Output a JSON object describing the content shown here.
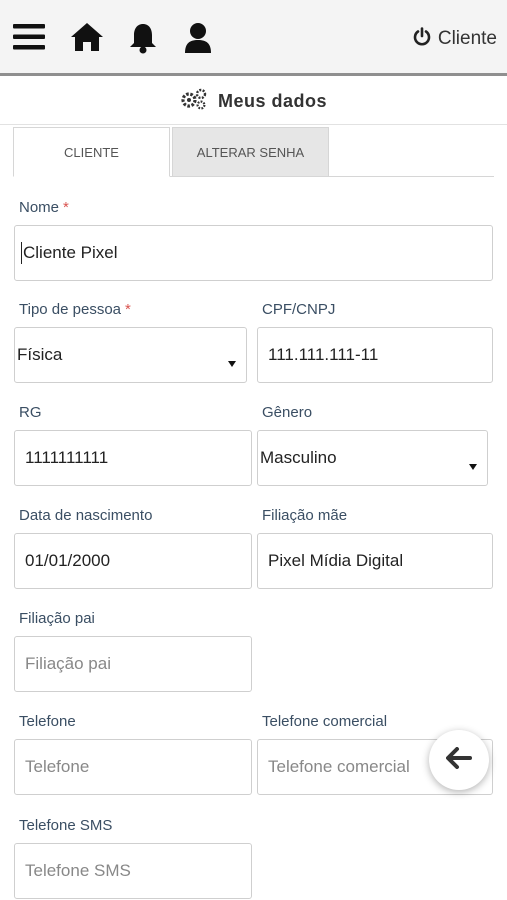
{
  "topbar": {
    "icons": [
      "menu-icon",
      "home-icon",
      "bell-icon",
      "user-icon",
      "power-icon"
    ],
    "logout_label": "Cliente"
  },
  "title": {
    "icon": "gears-icon",
    "text": "Meus dados"
  },
  "tabs": [
    {
      "label": "CLIENTE",
      "active": true
    },
    {
      "label": "ALTERAR SENHA",
      "active": false
    }
  ],
  "form": {
    "nome": {
      "label": "Nome",
      "required_mark": "*",
      "value": "Cliente Pixel"
    },
    "tipo_pessoa": {
      "label": "Tipo de pessoa",
      "required_mark": "*",
      "value": "Física"
    },
    "cpf_cnpj": {
      "label": "CPF/CNPJ",
      "value": "111.111.111-11"
    },
    "rg": {
      "label": "RG",
      "value": "1111111111"
    },
    "genero": {
      "label": "Gênero",
      "value": "Masculino"
    },
    "data_nascimento": {
      "label": "Data de nascimento",
      "value": "01/01/2000"
    },
    "filiacao_mae": {
      "label": "Filiação mãe",
      "value": "Pixel Mídia Digital"
    },
    "filiacao_pai": {
      "label": "Filiação pai",
      "placeholder": "Filiação pai"
    },
    "telefone": {
      "label": "Telefone",
      "placeholder": "Telefone"
    },
    "telefone_comercial": {
      "label": "Telefone comercial",
      "placeholder": "Telefone comercial"
    },
    "telefone_sms": {
      "label": "Telefone SMS",
      "placeholder": "Telefone SMS"
    }
  },
  "fab": {
    "icon": "arrow-left-icon"
  },
  "colors": {
    "label": "#3a4e63",
    "required": "#d9534f",
    "topbar_bg": "#f4f4f4"
  }
}
